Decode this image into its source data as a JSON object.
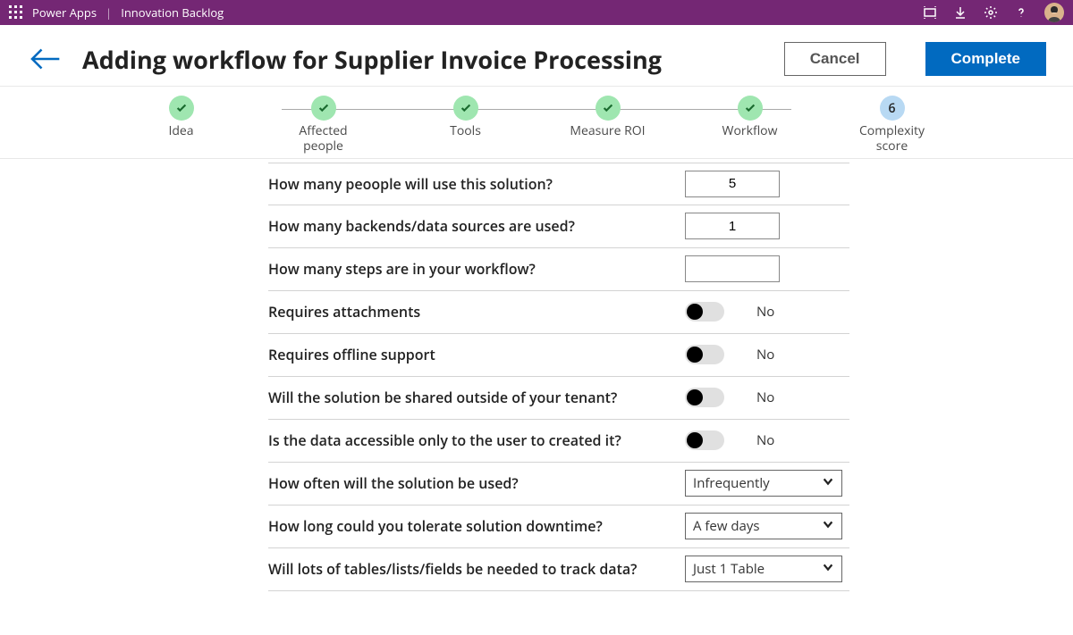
{
  "appbar": {
    "product": "Power Apps",
    "appname": "Innovation Backlog"
  },
  "header": {
    "title": "Adding workflow for Supplier Invoice Processing",
    "cancel": "Cancel",
    "complete": "Complete"
  },
  "stepper": {
    "steps": [
      {
        "label": "Idea",
        "state": "done"
      },
      {
        "label": "Affected people",
        "state": "done"
      },
      {
        "label": "Tools",
        "state": "done"
      },
      {
        "label": "Measure ROI",
        "state": "done"
      },
      {
        "label": "Workflow",
        "state": "done"
      },
      {
        "label": "Complexity score",
        "state": "current",
        "number": "6"
      }
    ]
  },
  "form": {
    "rows": [
      {
        "q": "How many peoople will use this solution?",
        "type": "number",
        "value": "5"
      },
      {
        "q": "How many backends/data sources are  used?",
        "type": "number",
        "value": "1"
      },
      {
        "q": "How many steps are in your workflow?",
        "type": "number",
        "value": ""
      },
      {
        "q": "Requires attachments",
        "type": "toggle",
        "on": false,
        "label": "No"
      },
      {
        "q": "Requires offline support",
        "type": "toggle",
        "on": false,
        "label": "No"
      },
      {
        "q": "Will the solution be shared  outside of your tenant?",
        "type": "toggle",
        "on": false,
        "label": "No"
      },
      {
        "q": "Is the data accessible only to the user to created it?",
        "type": "toggle",
        "on": false,
        "label": "No"
      },
      {
        "q": "How often will the solution be used?",
        "type": "select",
        "value": "Infrequently"
      },
      {
        "q": "How long could you tolerate solution downtime?",
        "type": "select",
        "value": "A few days"
      },
      {
        "q": "Will lots of tables/lists/fields be needed to track data?",
        "type": "select",
        "value": "Just 1 Table"
      }
    ]
  }
}
